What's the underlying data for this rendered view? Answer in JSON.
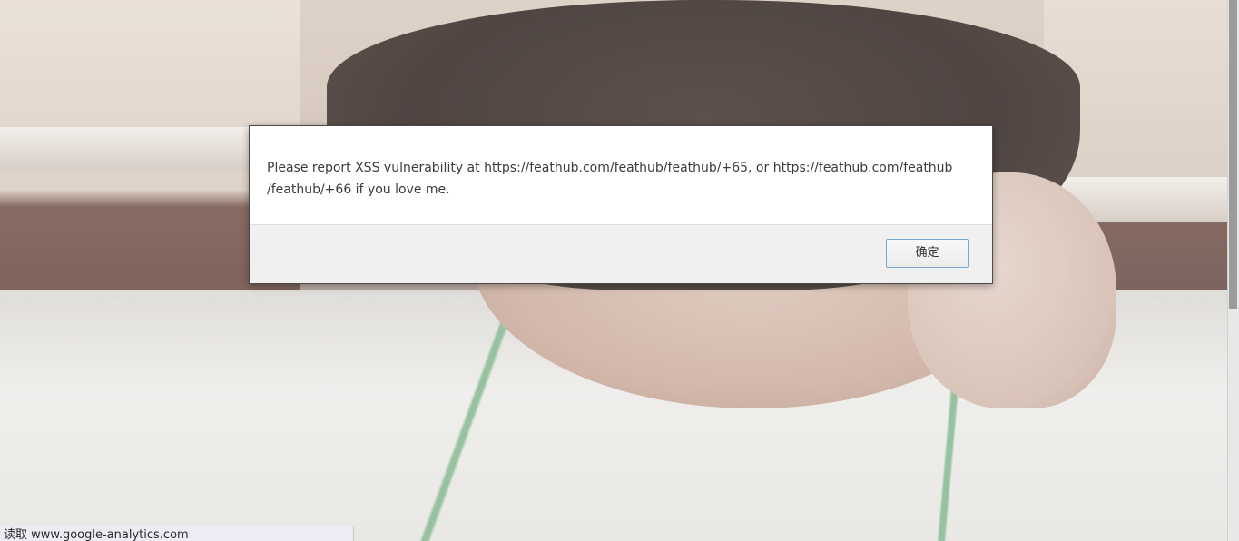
{
  "alert": {
    "message": "Please report XSS vulnerability at https://feathub.com/feathub/feathub/+65, or https://feathub.com/feathub\n/feathub/+66 if you love me.",
    "ok_label": "确定"
  },
  "status_bar": {
    "text": "读取 www.google-analytics.com"
  },
  "colors": {
    "dialog_border": "#4a4a4a",
    "button_border": "#7aa6d6",
    "footer_bg": "#f0f0f0"
  }
}
